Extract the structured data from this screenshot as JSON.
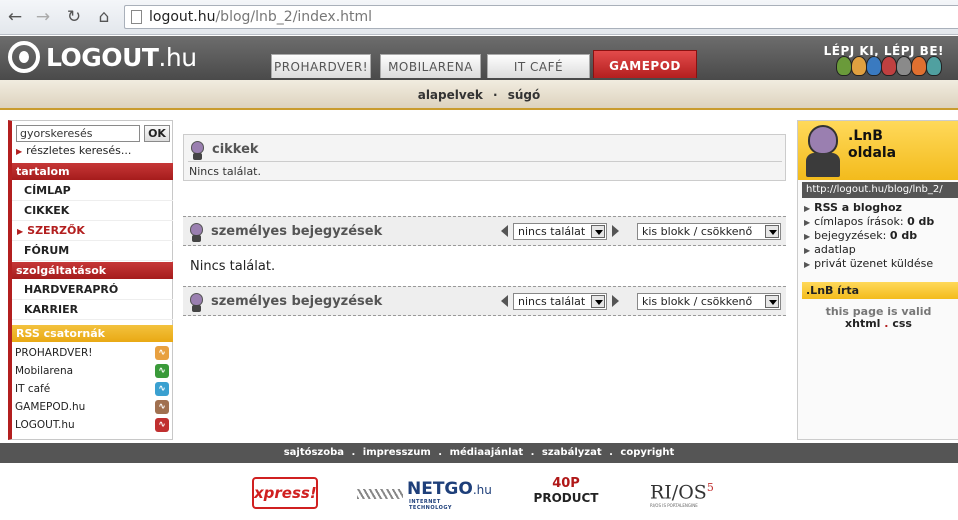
{
  "browser": {
    "url_host": "logout.hu",
    "url_path": "/blog/lnb_2/index.html"
  },
  "header": {
    "logo_text": "LOGOUT",
    "logo_suffix": ".hu",
    "tabs": [
      {
        "label": "PROHARDVER!"
      },
      {
        "label": "MOBILARENA"
      },
      {
        "label": "IT CAFÉ"
      },
      {
        "label": "GAMEPOD"
      }
    ],
    "slogan": "LÉPJ KI, LÉPJ BE!"
  },
  "subnav": {
    "items": [
      {
        "label": "alapelvek"
      },
      {
        "label": "súgó"
      }
    ],
    "separator": "·"
  },
  "sidebar": {
    "search_value": "gyorskeresés",
    "search_button": "OK",
    "advanced_search": "részletes keresés...",
    "section_content": "tartalom",
    "content_items": [
      {
        "label": "CÍMLAP"
      },
      {
        "label": "CIKKEK"
      },
      {
        "label": "SZERZŐK"
      },
      {
        "label": "FÓRUM"
      }
    ],
    "section_services": "szolgáltatások",
    "service_items": [
      {
        "label": "HARDVERAPRÓ"
      },
      {
        "label": "KARRIER"
      }
    ],
    "section_rss": "RSS csatornák",
    "rss_items": [
      {
        "label": "PROHARDVER!",
        "color": "#e8a040"
      },
      {
        "label": "Mobilarena",
        "color": "#3a9a3a"
      },
      {
        "label": "IT café",
        "color": "#3aa0d0"
      },
      {
        "label": "GAMEPOD.hu",
        "color": "#a07050"
      },
      {
        "label": "LOGOUT.hu",
        "color": "#c03030"
      }
    ]
  },
  "main": {
    "articles_title": "cikkek",
    "articles_empty": "Nincs találat.",
    "entries_title": "személyes bejegyzések",
    "entries_select1": "nincs találat",
    "entries_select2": "kis blokk / csökkenő",
    "entries_empty": "Nincs találat.",
    "entries_title_bottom": "személyes bejegyzések",
    "entries_select1_bottom": "nincs találat",
    "entries_select2_bottom": "kis blokk / csökkenő"
  },
  "right": {
    "profile_name_line1": ".LnB",
    "profile_name_line2": "oldala",
    "blog_url": "http://logout.hu/blog/lnb_2/",
    "links": [
      {
        "label": "RSS a bloghoz"
      },
      {
        "label": "címlapos írások:",
        "count": "0 db"
      },
      {
        "label": "bejegyzések:",
        "count": "0 db"
      },
      {
        "label": "adatlap"
      },
      {
        "label": "privát üzenet küldése"
      }
    ],
    "wrote_title": ".LnB írta",
    "valid_line1": "this page is valid",
    "valid_xhtml": "xhtml",
    "valid_css": "css",
    "valid_sep": "."
  },
  "footer": {
    "links": [
      {
        "label": "sajtószoba"
      },
      {
        "label": "impresszum"
      },
      {
        "label": "médiaajánlat"
      },
      {
        "label": "szabályzat"
      },
      {
        "label": "copyright"
      }
    ],
    "sep": "."
  },
  "sponsors": {
    "xpress": "xpress!",
    "netgo": "NETGO",
    "netgo_suffix": ".hu",
    "netgo_sub": "INTERNET TECHNOLOGY",
    "product_top": "40P",
    "product_bottom": "PRODUCT",
    "rios": "RI/OS",
    "rios_sup": "5",
    "rios_sub": "RI/OS IS PORTALENGINE"
  }
}
